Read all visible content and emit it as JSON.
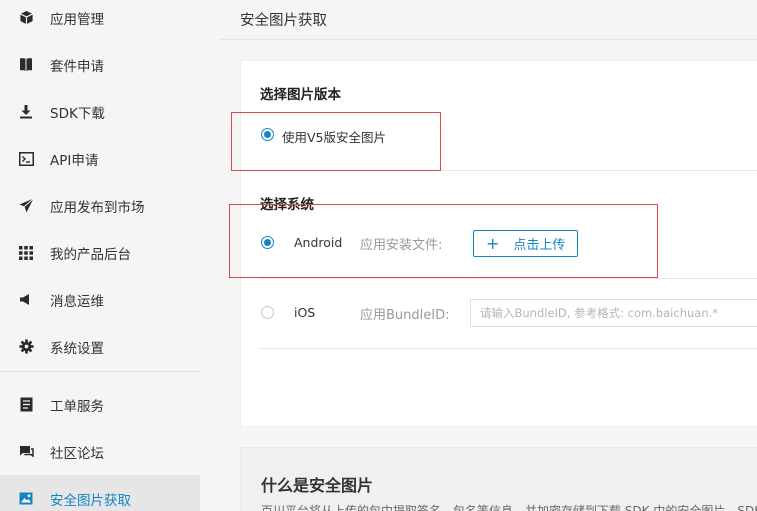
{
  "sidebar": {
    "items": [
      {
        "label": "应用管理",
        "icon": "cube-icon"
      },
      {
        "label": "套件申请",
        "icon": "book-icon"
      },
      {
        "label": "SDK下载",
        "icon": "download-icon"
      },
      {
        "label": "API申请",
        "icon": "terminal-icon"
      },
      {
        "label": "应用发布到市场",
        "icon": "send-icon"
      },
      {
        "label": "我的产品后台",
        "icon": "grid-icon"
      },
      {
        "label": "消息运维",
        "icon": "megaphone-icon"
      },
      {
        "label": "系统设置",
        "icon": "gear-icon"
      },
      {
        "label": "工单服务",
        "icon": "ticket-icon"
      },
      {
        "label": "社区论坛",
        "icon": "chat-icon"
      },
      {
        "label": "安全图片获取",
        "icon": "image-icon",
        "active": true
      }
    ]
  },
  "main": {
    "title": "安全图片获取",
    "version_section": {
      "title": "选择图片版本",
      "option_label": "使用V5版安全图片"
    },
    "system_section": {
      "title": "选择系统",
      "android": {
        "label": "Android",
        "field_label": "应用安装文件:",
        "upload_plus": "+",
        "upload_label": "点击上传"
      },
      "ios": {
        "label": "iOS",
        "field_label": "应用BundleID:",
        "placeholder": "请输入BundleID, 参考格式: com.baichuan.*"
      }
    },
    "info": {
      "title": "什么是安全图片",
      "text": "百川平台将从上传的包中提取签名、包名等信息，并加密存储到下载 SDK 中的安全图片。SDK"
    }
  },
  "colors": {
    "accent": "#1584c7",
    "highlight_box": "#d9474f"
  }
}
